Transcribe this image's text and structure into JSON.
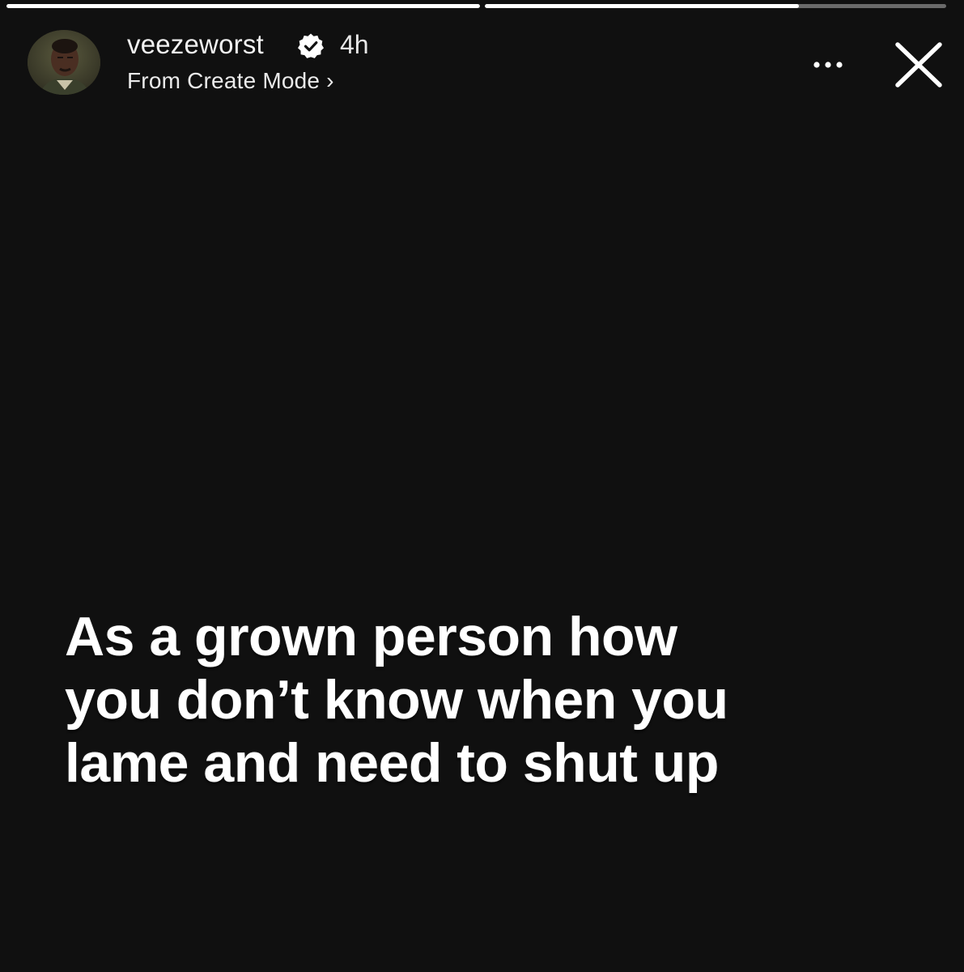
{
  "progress": [
    {
      "fraction": 1.0
    },
    {
      "fraction": 0.68
    }
  ],
  "header": {
    "username": "veezeworst",
    "verified_icon": "verified-badge-icon",
    "time": "4h",
    "subtitle": "From Create Mode",
    "subtitle_chevron": "›",
    "more_icon": "more-options-icon",
    "close_icon": "close-icon"
  },
  "story": {
    "lines": [
      "As a grown person how",
      "you don’t know when you",
      "lame and need to shut up"
    ]
  },
  "colors": {
    "background": "#101010",
    "text": "#ffffff",
    "progress_track": "#616161"
  }
}
